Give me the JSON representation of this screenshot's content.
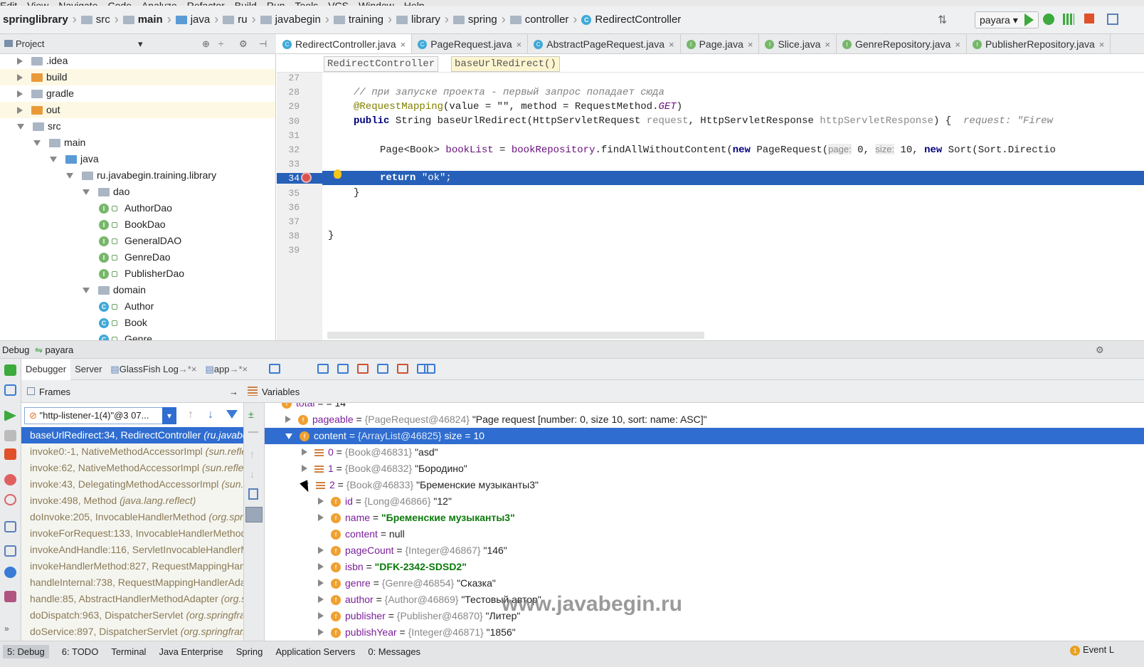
{
  "menu": [
    "Edit",
    "View",
    "Navigate",
    "Code",
    "Analyze",
    "Refactor",
    "Build",
    "Run",
    "Tools",
    "VCS",
    "Window",
    "Help"
  ],
  "breadcrumbs": [
    "springlibrary",
    "src",
    "main",
    "java",
    "ru",
    "javabegin",
    "training",
    "library",
    "spring",
    "controller",
    "RedirectController"
  ],
  "run_config": "payara",
  "project_panel": {
    "title": "Project"
  },
  "tree": [
    {
      "label": ".idea",
      "type": "folder",
      "indent": 0,
      "arrow": "r"
    },
    {
      "label": "build",
      "type": "folder-orange",
      "indent": 0,
      "arrow": "r"
    },
    {
      "label": "gradle",
      "type": "folder",
      "indent": 0,
      "arrow": "r"
    },
    {
      "label": "out",
      "type": "folder-orange",
      "indent": 0,
      "arrow": "r"
    },
    {
      "label": "src",
      "type": "folder",
      "indent": 0,
      "arrow": "d"
    },
    {
      "label": "main",
      "type": "folder",
      "indent": 1,
      "arrow": "d"
    },
    {
      "label": "java",
      "type": "folder-blue",
      "indent": 2,
      "arrow": "d"
    },
    {
      "label": "ru.javabegin.training.library",
      "type": "folder",
      "indent": 3,
      "arrow": "d"
    },
    {
      "label": "dao",
      "type": "folder",
      "indent": 4,
      "arrow": "d"
    },
    {
      "label": "AuthorDao",
      "type": "interface",
      "indent": 5
    },
    {
      "label": "BookDao",
      "type": "interface",
      "indent": 5
    },
    {
      "label": "GeneralDAO",
      "type": "interface",
      "indent": 5
    },
    {
      "label": "GenreDao",
      "type": "interface",
      "indent": 5
    },
    {
      "label": "PublisherDao",
      "type": "interface",
      "indent": 5
    },
    {
      "label": "domain",
      "type": "folder",
      "indent": 4,
      "arrow": "d"
    },
    {
      "label": "Author",
      "type": "class",
      "indent": 5
    },
    {
      "label": "Book",
      "type": "class",
      "indent": 5
    },
    {
      "label": "Genre",
      "type": "class",
      "indent": 5
    }
  ],
  "editor_tabs": [
    {
      "label": "RedirectController.java",
      "icon": "C",
      "active": true
    },
    {
      "label": "PageRequest.java",
      "icon": "C"
    },
    {
      "label": "AbstractPageRequest.java",
      "icon": "C"
    },
    {
      "label": "Page.java",
      "icon": "I"
    },
    {
      "label": "Slice.java",
      "icon": "I"
    },
    {
      "label": "GenreRepository.java",
      "icon": "I"
    },
    {
      "label": "PublisherRepository.java",
      "icon": "I"
    }
  ],
  "editor_crumbs": {
    "cls": "RedirectController",
    "method": "baseUrlRedirect()"
  },
  "code": {
    "lines": [
      "27",
      "28",
      "29",
      "30",
      "31",
      "32",
      "33",
      "34",
      "35",
      "36",
      "37",
      "38",
      "39"
    ],
    "comment": "// при запуске проекта - первый запрос попадает сюда",
    "annotation": "@RequestMapping",
    "annotation_args": "(value = \"\", method = RequestMethod.",
    "get": "GET",
    "close_paren": ")",
    "signature_kw": "public",
    "signature": " String baseUrlRedirect(HttpServletRequest ",
    "p1": "request",
    "sig_mid": ", HttpServletResponse ",
    "p2": "httpServletResponse",
    "sig_end": ") {",
    "inline_hint": "request: \"Firew",
    "line32_a": "Page<Book> ",
    "line32_var": "bookList",
    "line32_b": " = ",
    "line32_field": "bookRepository",
    "line32_c": ".findAllWithoutContent(",
    "kw_new": "new",
    "line32_d": " PageRequest(",
    "hint_page": "page:",
    "line32_e": " 0, ",
    "hint_size": "size:",
    "line32_f": " 10, ",
    "line32_g": " Sort(Sort.Directio",
    "line34_kw": "return",
    "line34_str": " \"ok\";",
    "brace_inner": "}",
    "brace_outer": "}"
  },
  "debug": {
    "title": "Debug",
    "config": "payara",
    "tabs": [
      "Debugger",
      "Server",
      "GlassFish Log",
      "app"
    ],
    "frames_title": "Frames",
    "variables_title": "Variables",
    "thread": "\"http-listener-1(4)\"@3 07...",
    "frames": [
      {
        "m": "baseUrlRedirect:34, RedirectController",
        "p": "(ru.javabeg",
        "sel": true
      },
      {
        "m": "invoke0:-1, NativeMethodAccessorImpl",
        "p": "(sun.reflec"
      },
      {
        "m": "invoke:62, NativeMethodAccessorImpl",
        "p": "(sun.reflect,"
      },
      {
        "m": "invoke:43, DelegatingMethodAccessorImpl",
        "p": "(sun.re"
      },
      {
        "m": "invoke:498, Method",
        "p": "(java.lang.reflect)"
      },
      {
        "m": "doInvoke:205, InvocableHandlerMethod",
        "p": "(org.sprin"
      },
      {
        "m": "invokeForRequest:133, InvocableHandlerMethod",
        "p": ""
      },
      {
        "m": "invokeAndHandle:116, ServletInvocableHandlerM",
        "p": ""
      },
      {
        "m": "invokeHandlerMethod:827, RequestMappingHand",
        "p": ""
      },
      {
        "m": "handleInternal:738, RequestMappingHandlerAdap",
        "p": ""
      },
      {
        "m": "handle:85, AbstractHandlerMethodAdapter",
        "p": "(org.sp"
      },
      {
        "m": "doDispatch:963, DispatcherServlet",
        "p": "(org.springfram"
      },
      {
        "m": "doService:897, DispatcherServlet",
        "p": "(org.springframe"
      }
    ],
    "variables": [
      {
        "indent": 0,
        "arrow": "",
        "icon": "f",
        "name": "total",
        "type": "",
        "val": "= 14",
        "partial": true
      },
      {
        "indent": 1,
        "arrow": "r",
        "icon": "f",
        "name": "pageable",
        "type": "{PageRequest@46824}",
        "val": "\"Page request [number: 0, size 10, sort: name: ASC]\""
      },
      {
        "indent": 1,
        "arrow": "d",
        "icon": "f",
        "name": "content",
        "type": "{ArrayList@46825}",
        "val": "size = 10",
        "sel": true
      },
      {
        "indent": 2,
        "arrow": "r",
        "icon": "l",
        "name": "0",
        "type": "{Book@46831}",
        "val": "\"asd\""
      },
      {
        "indent": 2,
        "arrow": "r",
        "icon": "l",
        "name": "1",
        "type": "{Book@46832}",
        "val": "\"Бородино\""
      },
      {
        "indent": 2,
        "arrow": "d",
        "icon": "l",
        "name": "2",
        "type": "{Book@46833}",
        "val": "\"Бременские музыканты3\""
      },
      {
        "indent": 3,
        "arrow": "r",
        "icon": "f",
        "name": "id",
        "type": "{Long@46866}",
        "val": "\"12\""
      },
      {
        "indent": 3,
        "arrow": "r",
        "icon": "f",
        "name": "name",
        "type": "",
        "val": "\"Бременские музыканты3\"",
        "green": true
      },
      {
        "indent": 3,
        "arrow": "",
        "icon": "f",
        "name": "content",
        "type": "",
        "val": "null"
      },
      {
        "indent": 3,
        "arrow": "r",
        "icon": "f",
        "name": "pageCount",
        "type": "{Integer@46867}",
        "val": "\"146\""
      },
      {
        "indent": 3,
        "arrow": "r",
        "icon": "f",
        "name": "isbn",
        "type": "",
        "val": "\"DFK-2342-SDSD2\"",
        "green": true
      },
      {
        "indent": 3,
        "arrow": "r",
        "icon": "f",
        "name": "genre",
        "type": "{Genre@46854}",
        "val": "\"Сказка\""
      },
      {
        "indent": 3,
        "arrow": "r",
        "icon": "f",
        "name": "author",
        "type": "{Author@46869}",
        "val": "\"Тестовый автор\""
      },
      {
        "indent": 3,
        "arrow": "r",
        "icon": "f",
        "name": "publisher",
        "type": "{Publisher@46870}",
        "val": "\"Литер\""
      },
      {
        "indent": 3,
        "arrow": "r",
        "icon": "f",
        "name": "publishYear",
        "type": "{Integer@46871}",
        "val": "\"1856\""
      }
    ]
  },
  "watermark": "www.javabegin.ru",
  "statusbar": [
    "5: Debug",
    "6: TODO",
    "Terminal",
    "Java Enterprise",
    "Spring",
    "Application Servers",
    "0: Messages"
  ],
  "event_log": "Event L"
}
